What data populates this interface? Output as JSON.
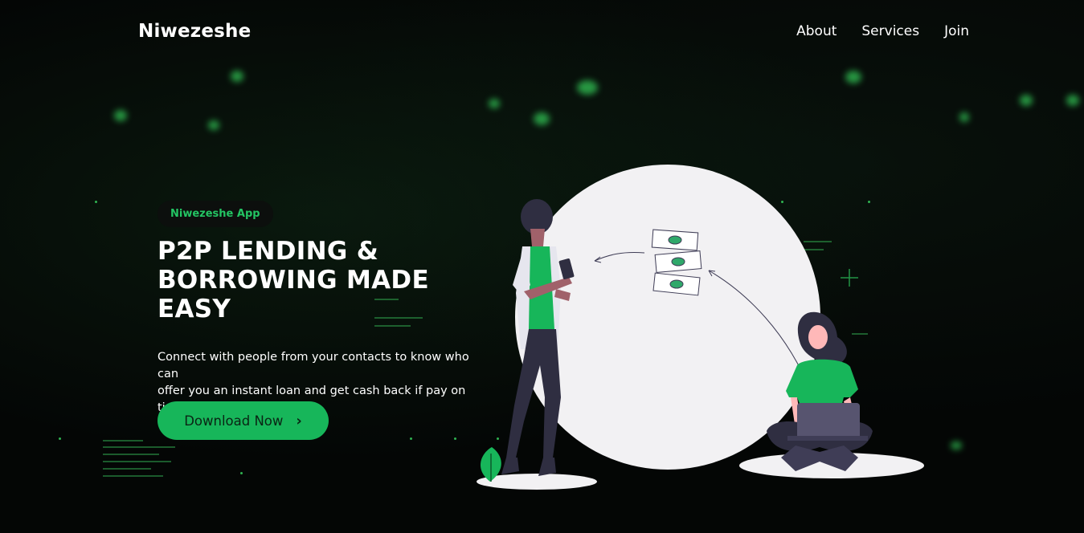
{
  "header": {
    "logo": "Niwezeshe",
    "nav": [
      "About",
      "Services",
      "Join"
    ]
  },
  "hero": {
    "badge": "Niwezeshe App",
    "title_lines": [
      "P2P LENDING &",
      "BORROWING MADE",
      "EASY"
    ],
    "description_lines": [
      "Connect with people from your contacts to know who can",
      "offer you an instant loan and get cash back if pay on time"
    ],
    "cta_label": "Download Now",
    "cta_icon": "chevron-right-icon"
  },
  "illustration": {
    "name": "people-exchanging-money-illustration"
  },
  "colors": {
    "accent": "#17b65a",
    "badge_text": "#23c463",
    "background": "#040605"
  }
}
